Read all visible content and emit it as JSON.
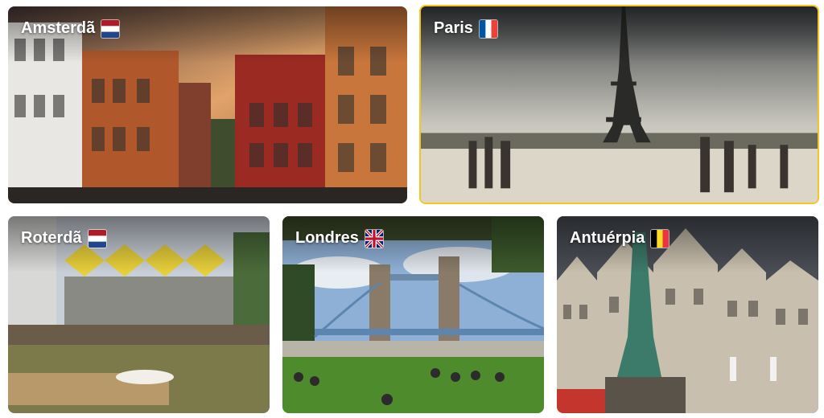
{
  "cities": [
    {
      "name": "Amsterdã",
      "flag": "netherlands-flag-icon"
    },
    {
      "name": "Paris",
      "flag": "france-flag-icon",
      "selected": true
    },
    {
      "name": "Roterdã",
      "flag": "netherlands-flag-icon"
    },
    {
      "name": "Londres",
      "flag": "uk-flag-icon"
    },
    {
      "name": "Antuérpia",
      "flag": "belgium-flag-icon"
    }
  ],
  "colors": {
    "selected_border": "#f3c623"
  }
}
